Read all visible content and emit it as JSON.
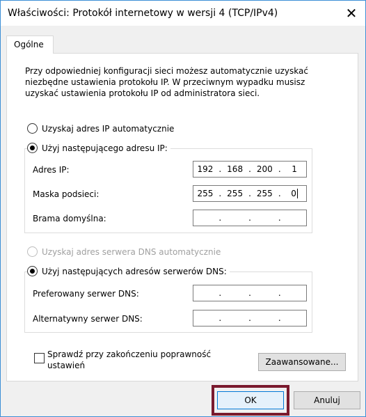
{
  "window": {
    "title": "Właściwości: Protokół internetowy w wersji 4 (TCP/IPv4)",
    "close": "✕"
  },
  "tab": {
    "label": "Ogólne"
  },
  "description": "Przy odpowiedniej konfiguracji sieci możesz automatycznie uzyskać niezbędne ustawienia protokołu IP. W przeciwnym wypadku musisz uzyskać ustawienia protokołu IP od administratora sieci.",
  "ip": {
    "auto_label": "Uzyskaj adres IP automatycznie",
    "manual_label": "Użyj następującego adresu IP:",
    "address_label": "Adres IP:",
    "address": [
      "192",
      "168",
      "200",
      "1"
    ],
    "mask_label": "Maska podsieci:",
    "mask": [
      "255",
      "255",
      "255",
      "0"
    ],
    "gateway_label": "Brama domyślna:",
    "gateway": [
      "",
      "",
      "",
      ""
    ]
  },
  "dns": {
    "auto_label": "Uzyskaj adres serwera DNS automatycznie",
    "manual_label": "Użyj następujących adresów serwerów DNS:",
    "preferred_label": "Preferowany serwer DNS:",
    "preferred": [
      "",
      "",
      "",
      ""
    ],
    "alternate_label": "Alternatywny serwer DNS:",
    "alternate": [
      "",
      "",
      "",
      ""
    ]
  },
  "validate": {
    "label": "Sprawdź przy zakończeniu poprawność ustawień"
  },
  "buttons": {
    "advanced": "Zaawansowane...",
    "ok": "OK",
    "cancel": "Anuluj"
  },
  "colors": {
    "accent": "#0078d7",
    "highlight": "#7a1a2e"
  }
}
